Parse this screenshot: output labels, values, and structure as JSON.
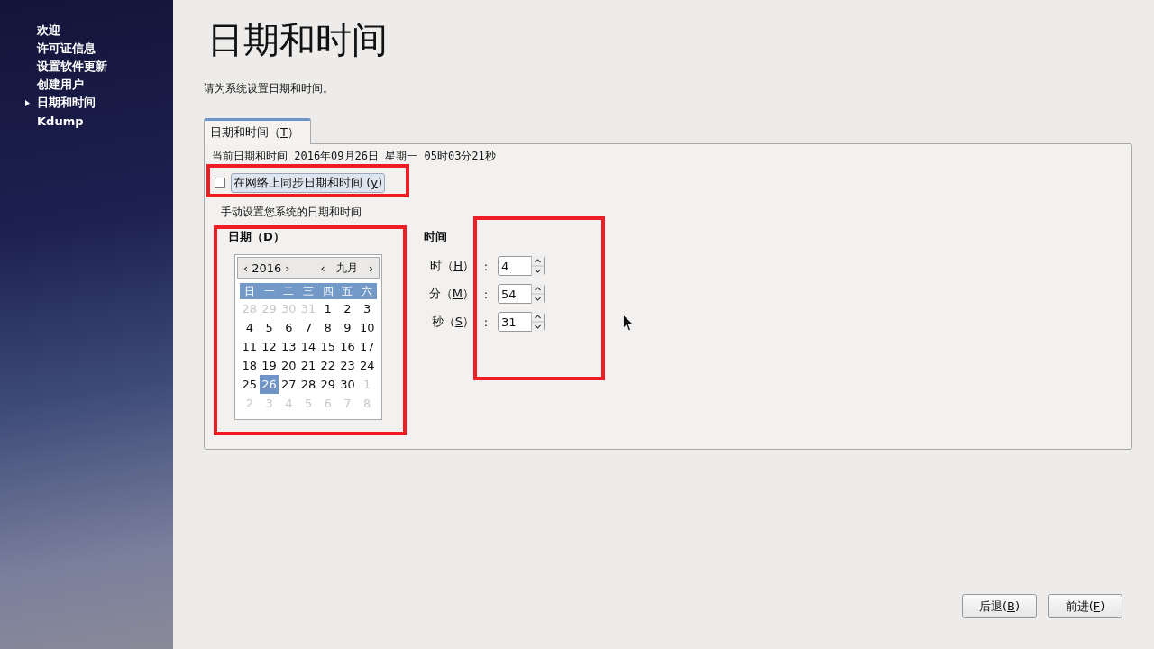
{
  "sidebar": {
    "items": [
      {
        "label": "欢迎",
        "selected": false
      },
      {
        "label": "许可证信息",
        "selected": false
      },
      {
        "label": "设置软件更新",
        "selected": false
      },
      {
        "label": "创建用户",
        "selected": false
      },
      {
        "label": "日期和时间",
        "selected": true
      },
      {
        "label": "Kdump",
        "selected": false
      }
    ]
  },
  "title": "日期和时间",
  "subtitle": "请为系统设置日期和时间。",
  "tabs": [
    {
      "before": "日期和时间（",
      "key": "T",
      "after": "）",
      "selected": true
    }
  ],
  "current_datetime": "当前日期和时间  2016年09月26日  星期一  05时03分21秒",
  "network_sync": {
    "before": "在网络上同步日期和时间 (",
    "key": "y",
    "after": ")",
    "checked": false
  },
  "manual_label": "手动设置您系统的日期和时间",
  "date": {
    "heading": {
      "before": "日期（",
      "key": "D",
      "after": "）"
    },
    "year": "2016",
    "month": "九月",
    "prev_symbol": "‹",
    "next_symbol": "›",
    "weekdays": [
      "日",
      "一",
      "二",
      "三",
      "四",
      "五",
      "六"
    ],
    "weeks": [
      [
        {
          "day": "28",
          "other_month": true,
          "selected": false
        },
        {
          "day": "29",
          "other_month": true,
          "selected": false
        },
        {
          "day": "30",
          "other_month": true,
          "selected": false
        },
        {
          "day": "31",
          "other_month": true,
          "selected": false
        },
        {
          "day": "1",
          "other_month": false,
          "selected": false
        },
        {
          "day": "2",
          "other_month": false,
          "selected": false
        },
        {
          "day": "3",
          "other_month": false,
          "selected": false
        }
      ],
      [
        {
          "day": "4",
          "other_month": false,
          "selected": false
        },
        {
          "day": "5",
          "other_month": false,
          "selected": false
        },
        {
          "day": "6",
          "other_month": false,
          "selected": false
        },
        {
          "day": "7",
          "other_month": false,
          "selected": false
        },
        {
          "day": "8",
          "other_month": false,
          "selected": false
        },
        {
          "day": "9",
          "other_month": false,
          "selected": false
        },
        {
          "day": "10",
          "other_month": false,
          "selected": false
        }
      ],
      [
        {
          "day": "11",
          "other_month": false,
          "selected": false
        },
        {
          "day": "12",
          "other_month": false,
          "selected": false
        },
        {
          "day": "13",
          "other_month": false,
          "selected": false
        },
        {
          "day": "14",
          "other_month": false,
          "selected": false
        },
        {
          "day": "15",
          "other_month": false,
          "selected": false
        },
        {
          "day": "16",
          "other_month": false,
          "selected": false
        },
        {
          "day": "17",
          "other_month": false,
          "selected": false
        }
      ],
      [
        {
          "day": "18",
          "other_month": false,
          "selected": false
        },
        {
          "day": "19",
          "other_month": false,
          "selected": false
        },
        {
          "day": "20",
          "other_month": false,
          "selected": false
        },
        {
          "day": "21",
          "other_month": false,
          "selected": false
        },
        {
          "day": "22",
          "other_month": false,
          "selected": false
        },
        {
          "day": "23",
          "other_month": false,
          "selected": false
        },
        {
          "day": "24",
          "other_month": false,
          "selected": false
        }
      ],
      [
        {
          "day": "25",
          "other_month": false,
          "selected": false
        },
        {
          "day": "26",
          "other_month": false,
          "selected": true
        },
        {
          "day": "27",
          "other_month": false,
          "selected": false
        },
        {
          "day": "28",
          "other_month": false,
          "selected": false
        },
        {
          "day": "29",
          "other_month": false,
          "selected": false
        },
        {
          "day": "30",
          "other_month": false,
          "selected": false
        },
        {
          "day": "1",
          "other_month": true,
          "selected": false
        }
      ],
      [
        {
          "day": "2",
          "other_month": true,
          "selected": false
        },
        {
          "day": "3",
          "other_month": true,
          "selected": false
        },
        {
          "day": "4",
          "other_month": true,
          "selected": false
        },
        {
          "day": "5",
          "other_month": true,
          "selected": false
        },
        {
          "day": "6",
          "other_month": true,
          "selected": false
        },
        {
          "day": "7",
          "other_month": true,
          "selected": false
        },
        {
          "day": "8",
          "other_month": true,
          "selected": false
        }
      ]
    ]
  },
  "time": {
    "heading": "时间",
    "fields": [
      {
        "before": "时（",
        "key": "H",
        "after": "）",
        "colon": ":",
        "value": "4"
      },
      {
        "before": "分（",
        "key": "M",
        "after": "）",
        "colon": ":",
        "value": "54"
      },
      {
        "before": "秒（",
        "key": "S",
        "after": "）",
        "colon": ":",
        "value": "31"
      }
    ]
  },
  "buttons": [
    {
      "before": "后退(",
      "key": "B",
      "after": ")"
    },
    {
      "before": "前进(",
      "key": "F",
      "after": ")"
    }
  ]
}
